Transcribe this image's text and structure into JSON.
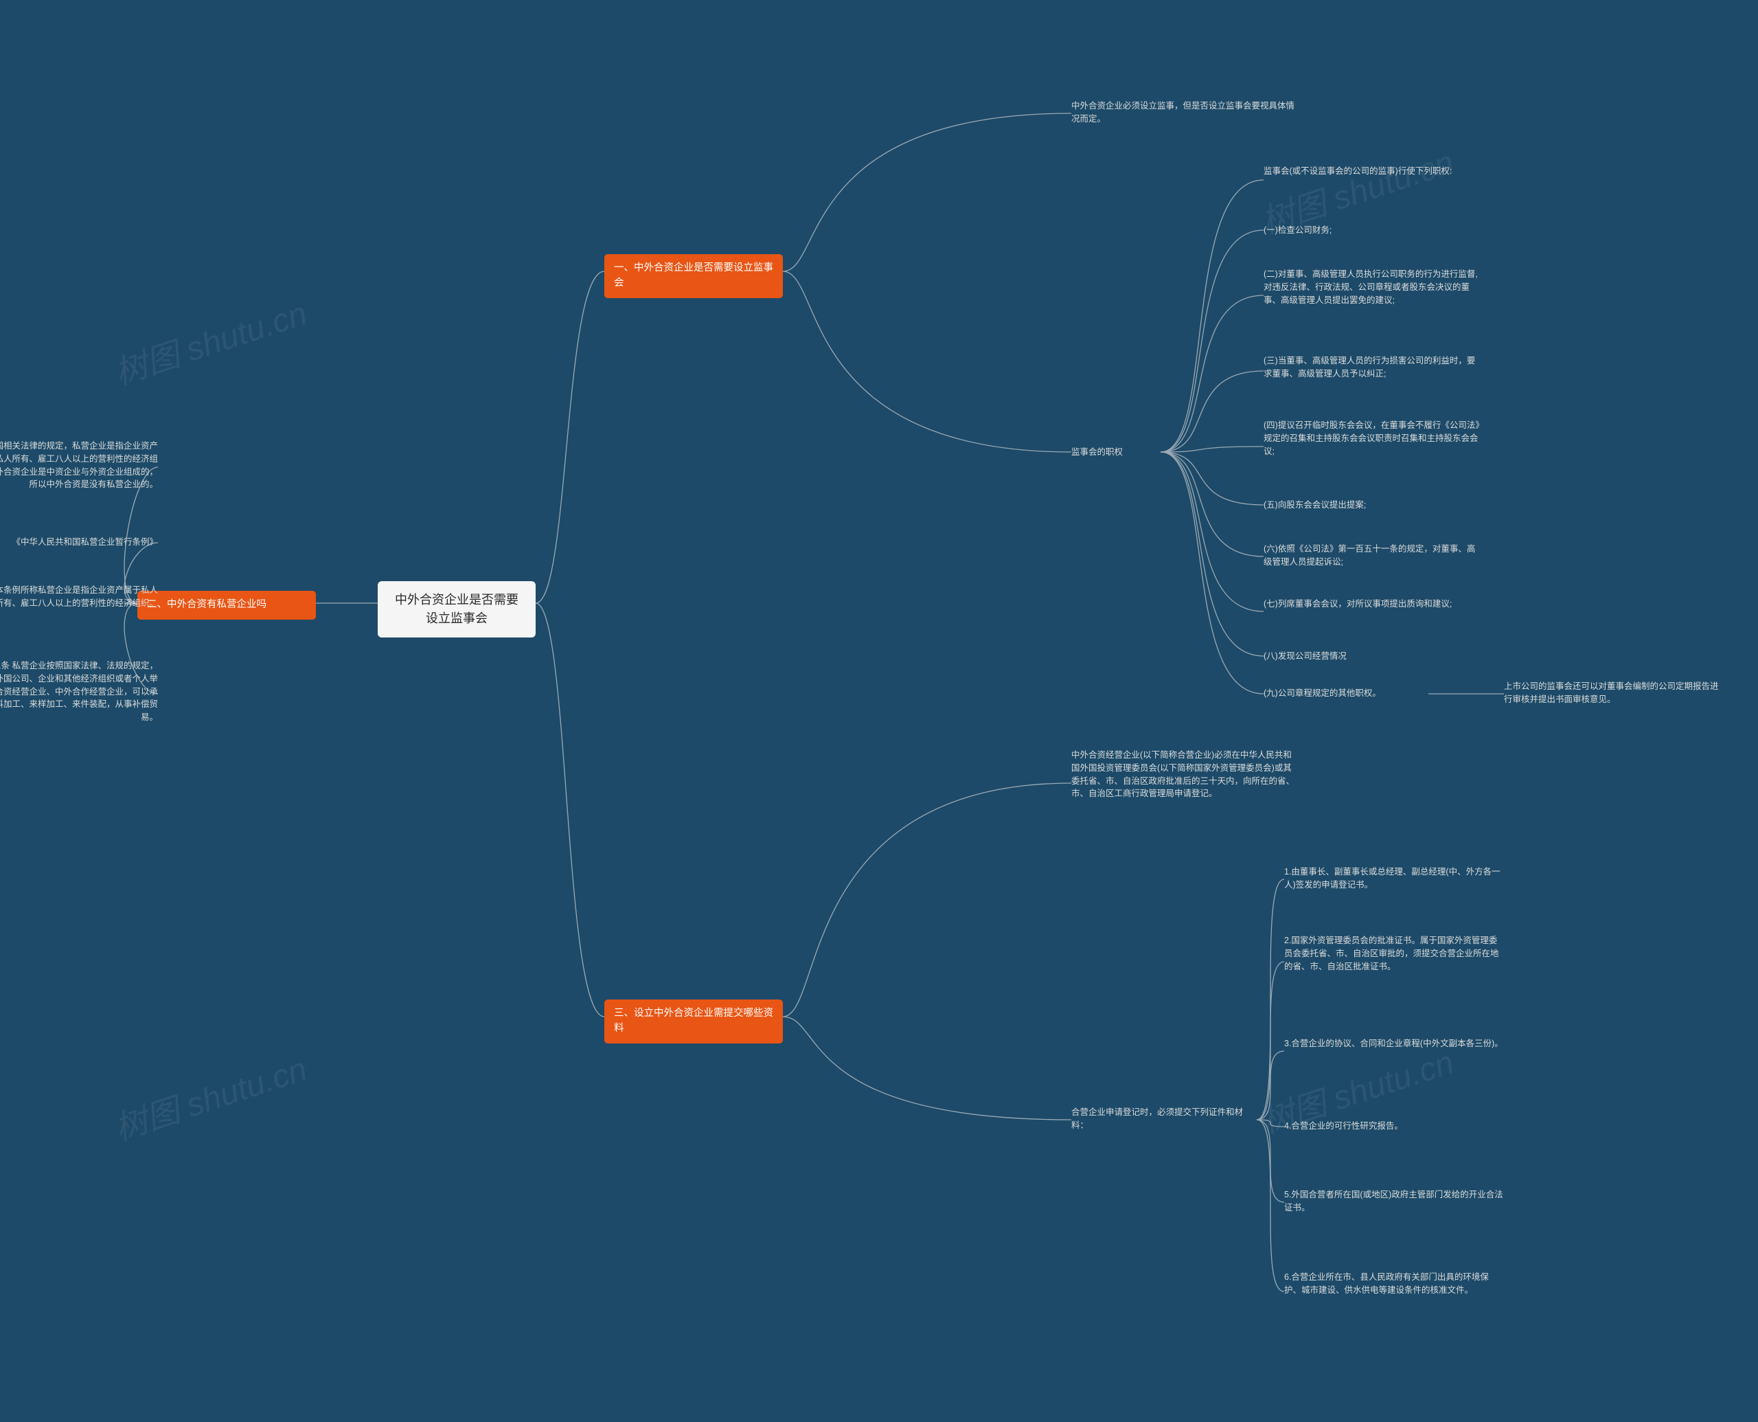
{
  "watermark": "树图 shutu.cn",
  "root": "中外合资企业是否需要设立监事会",
  "branch1": {
    "title": "一、中外合资企业是否需要设立监事会",
    "leaf_intro": "中外合资企业必须设立监事，但是否设立监事会要视具体情况而定。",
    "sub_label": "监事会的职权",
    "powers": {
      "p0": "监事会(或不设监事会的公司的监事)行使下列职权:",
      "p1": "(一)检查公司财务;",
      "p2": "(二)对董事、高级管理人员执行公司职务的行为进行监督,对违反法律、行政法规、公司章程或者股东会决议的董事、高级管理人员提出罢免的建议;",
      "p3": "(三)当董事、高级管理人员的行为损害公司的利益时，要求董事、高级管理人员予以纠正;",
      "p4": "(四)提议召开临时股东会会议，在董事会不履行《公司法》规定的召集和主持股东会会议职责时召集和主持股东会会议;",
      "p5": "(五)向股东会会议提出提案;",
      "p6": "(六)依照《公司法》第一百五十一条的规定，对董事、高级管理人员提起诉讼;",
      "p7": "(七)列席董事会会议，对所议事项提出质询和建议;",
      "p8": "(八)发现公司经营情况",
      "p9": "(九)公司章程规定的其他职权。",
      "p9_extra": "上市公司的监事会还可以对董事会编制的公司定期报告进行审核并提出书面审核意见。"
    }
  },
  "branch2": {
    "title": "二、中外合资有私营企业吗",
    "l1": "依据我国相关法律的规定，私营企业是指企业资产属于私人所有、雇工八人以上的营利性的经济组织，中外合资企业是中资企业与外资企业组成的，所以中外合资是没有私营企业的。",
    "l2": "《中华人民共和国私营企业暂行条例》",
    "l3": "第二条 本条例所称私营企业是指企业资产属于私人所有、雇工八人以上的营利性的经济组织。",
    "l4": "第二十二条 私营企业按照国家法律、法规的规定，可以同外国公司、企业和其他经济组织或者个人举办中外合资经营企业、中外合作经营企业，可以承揽来料加工、来样加工、来件装配，从事补偿贸易。"
  },
  "branch3": {
    "title": "三、设立中外合资企业需提交哪些资料",
    "intro": "中外合资经营企业(以下简称合营企业)必须在中华人民共和国外国投资管理委员会(以下简称国家外资管理委员会)或其委托省、市、自治区政府批准后的三十天内，向所在的省、市、自治区工商行政管理局申请登记。",
    "sub_label": "合营企业申请登记时，必须提交下列证件和材料：",
    "docs": {
      "d1": "1.由董事长、副董事长或总经理、副总经理(中、外方各一人)签发的申请登记书。",
      "d2": "2.国家外资管理委员会的批准证书。属于国家外资管理委员会委托省、市、自治区审批的，须提交合营企业所在地的省、市、自治区批准证书。",
      "d3": "3.合营企业的协议、合同和企业章程(中外文副本各三份)。",
      "d4": "4.合营企业的可行性研究报告。",
      "d5": "5.外国合营者所在国(或地区)政府主管部门发给的开业合法证书。",
      "d6": "6.合营企业所在市、县人民政府有关部门出具的环境保护、城市建设、供水供电等建设条件的核准文件。"
    }
  }
}
